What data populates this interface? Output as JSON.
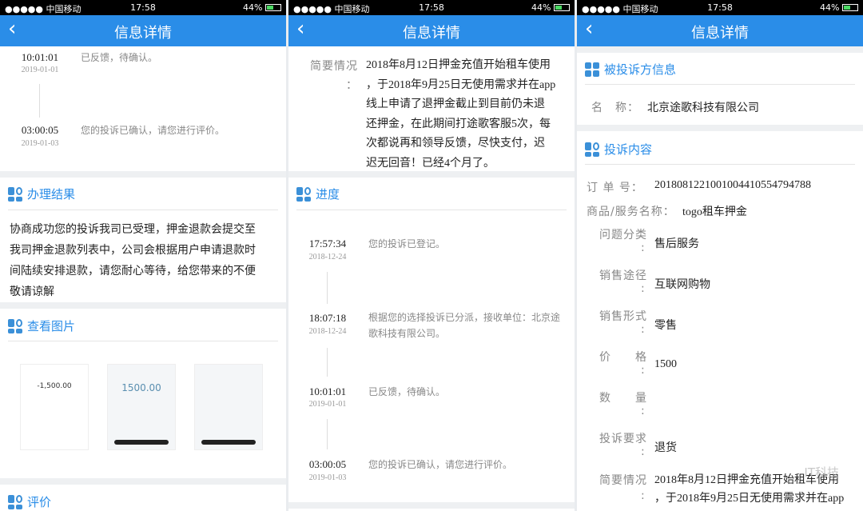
{
  "status": {
    "carrier": "●●●●● 中国移动",
    "time": "17:58",
    "battery": "44%"
  },
  "nav": {
    "title": "信息详情",
    "back": "‹"
  },
  "p1": {
    "timeline": [
      {
        "time": "10:01:01",
        "date": "2019-01-01",
        "msg": "已反馈，待确认。"
      },
      {
        "time": "03:00:05",
        "date": "2019-01-03",
        "msg": "您的投诉已确认，请您进行评价。"
      }
    ],
    "result_title": "办理结果",
    "result_lines": [
      "协商成功您的投诉我司已受理，押金退款会提交至",
      "我司押金退款列表中，公司会根据用户申请退款时",
      "间陆续安排退款，请您耐心等待，给您带来的不便",
      "敬请谅解"
    ],
    "images_title": "查看图片",
    "thumb_amounts": [
      "-1,500.00",
      "1500.00"
    ],
    "rating_title": "评价"
  },
  "p2": {
    "summary_label": "简要情况",
    "colon": "：",
    "summary_lines": [
      "2018年8月12日押金充值开始租车使用",
      "，于2018年9月25日无使用需求并在app",
      "线上申请了退押金截止到目前仍未退",
      "还押金，在此期间打途歌客服5次，每",
      "次都说再和领导反馈，尽快支付，迟",
      "迟无回音！已经4个月了。"
    ],
    "progress_title": "进度",
    "timeline": [
      {
        "time": "17:57:34",
        "date": "2018-12-24",
        "msg": "您的投诉已登记。"
      },
      {
        "time": "18:07:18",
        "date": "2018-12-24",
        "msg": "根据您的选择投诉已分派，接收单位：北京途歌科技有限公司。"
      },
      {
        "time": "10:01:01",
        "date": "2019-01-01",
        "msg": "已反馈，待确认。"
      },
      {
        "time": "03:00:05",
        "date": "2019-01-03",
        "msg": "您的投诉已确认，请您进行评价。"
      }
    ]
  },
  "p3": {
    "respondent_title": "被投诉方信息",
    "name_label": "名　称：",
    "name_value": "北京途歌科技有限公司",
    "content_title": "投诉内容",
    "order_label": "订 单 号：",
    "order_value": "201808122100100441055479478​8",
    "product_label": "商品/服务名称：",
    "product_value": "togo租车押金",
    "fields": [
      {
        "label": "问题分类",
        "value": "售后服务"
      },
      {
        "label": "销售途径",
        "value": "互联网购物"
      },
      {
        "label": "销售形式",
        "value": "零售"
      },
      {
        "label": "价　　格",
        "value": "1500"
      },
      {
        "label": "数　　量",
        "value": ""
      },
      {
        "label": "投诉要求",
        "value": "退货"
      }
    ],
    "summary_label": "简要情况",
    "summary_lines": [
      "2018年8月12日押金充值开始租车使用",
      "，于2018年9月25日无使用需求并在app"
    ],
    "watermark": "IT科技"
  }
}
